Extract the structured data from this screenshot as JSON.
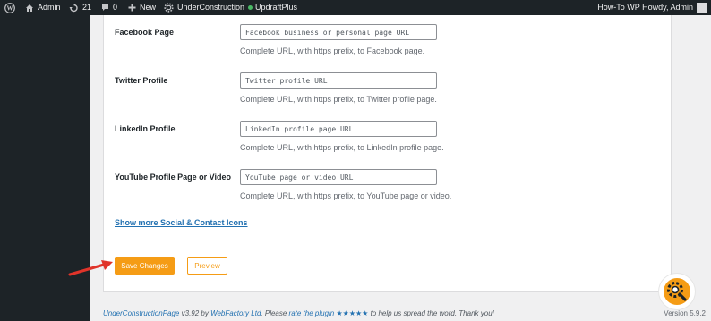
{
  "admin_bar": {
    "site_name": "Admin",
    "updates_count": "21",
    "comments_count": "0",
    "new_label": "New",
    "plugin_label": "UnderConstruction",
    "updraft_label": "UpdraftPlus",
    "howdy_text": "How-To WP Howdy, Admin"
  },
  "form": {
    "rows": [
      {
        "label": "Facebook Page",
        "placeholder": "Facebook business or personal page URL",
        "help": "Complete URL, with https prefix, to Facebook page."
      },
      {
        "label": "Twitter Profile",
        "placeholder": "Twitter profile URL",
        "help": "Complete URL, with https prefix, to Twitter profile page."
      },
      {
        "label": "LinkedIn Profile",
        "placeholder": "LinkedIn profile page URL",
        "help": "Complete URL, with https prefix, to LinkedIn profile page."
      },
      {
        "label": "YouTube Profile Page or Video",
        "placeholder": "YouTube page or video URL",
        "help": "Complete URL, with https prefix, to YouTube page or video."
      }
    ],
    "show_more_link": "Show more Social & Contact Icons",
    "save_button": "Save Changes",
    "preview_button": "Preview"
  },
  "footer": {
    "plugin_link": "UnderConstructionPage",
    "version_by": " v3.92 by ",
    "author_link": "WebFactory Ltd",
    "please": ". Please ",
    "rate_link": "rate the plugin ★★★★★",
    "tail": " to help us spread the word. Thank you!",
    "wp_version": "Version 5.9.2"
  },
  "colors": {
    "accent": "#f59c15",
    "link": "#2271b1",
    "admin_bar": "#1d2327",
    "arrow": "#e0342a"
  }
}
